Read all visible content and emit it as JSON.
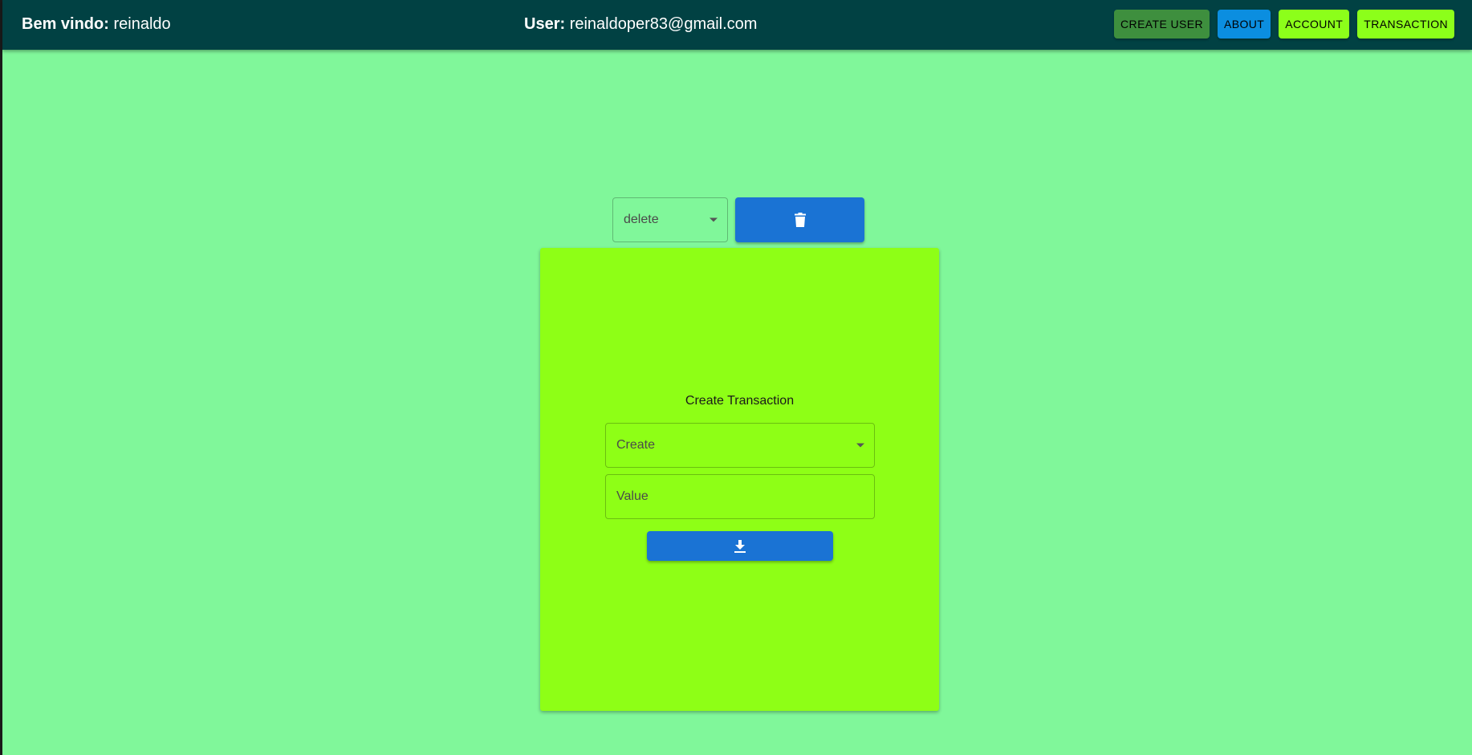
{
  "header": {
    "welcome_label": "Bem vindo:",
    "welcome_name": "reinaldo",
    "user_label": "User:",
    "user_email": "reinaldoper83@gmail.com",
    "nav": [
      {
        "label": "CREATE USER",
        "color": "#3e8f3e"
      },
      {
        "label": "ABOUT",
        "color": "#0b8ee0"
      },
      {
        "label": "ACCOUNT",
        "color": "#8cff1a"
      },
      {
        "label": "TRANSACTION",
        "color": "#8cff1a"
      }
    ]
  },
  "delete_section": {
    "select_value": "delete",
    "button_icon": "trash-icon"
  },
  "transaction_form": {
    "title": "Create Transaction",
    "type_select_value": "Create",
    "value_placeholder": "Value",
    "submit_icon": "download-icon"
  },
  "colors": {
    "page_background": "#80f79a",
    "header_background": "#014143",
    "card_background": "#8eff16",
    "primary_button": "#1a73d4"
  }
}
